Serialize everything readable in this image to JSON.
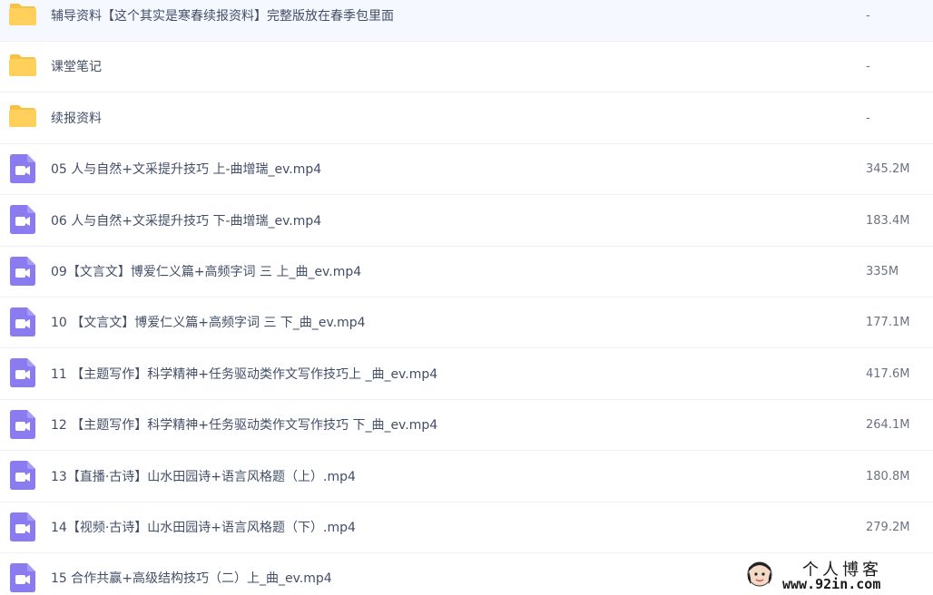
{
  "files": [
    {
      "type": "folder",
      "name": "辅导资料【这个其实是寒春续报资料】完整版放在春季包里面",
      "size": "-"
    },
    {
      "type": "folder",
      "name": "课堂笔记",
      "size": "-"
    },
    {
      "type": "folder",
      "name": "续报资料",
      "size": "-"
    },
    {
      "type": "video",
      "name": "05 人与自然+文采提升技巧 上-曲增瑞_ev.mp4",
      "size": "345.2M"
    },
    {
      "type": "video",
      "name": "06 人与自然+文采提升技巧 下-曲增瑞_ev.mp4",
      "size": "183.4M"
    },
    {
      "type": "video",
      "name": "09【文言文】博爱仁义篇+高频字词 三 上_曲_ev.mp4",
      "size": "335M"
    },
    {
      "type": "video",
      "name": "10 【文言文】博爱仁义篇+高频字词 三 下_曲_ev.mp4",
      "size": "177.1M"
    },
    {
      "type": "video",
      "name": "11 【主题写作】科学精神+任务驱动类作文写作技巧上 _曲_ev.mp4",
      "size": "417.6M"
    },
    {
      "type": "video",
      "name": "12 【主题写作】科学精神+任务驱动类作文写作技巧 下_曲_ev.mp4",
      "size": "264.1M"
    },
    {
      "type": "video",
      "name": "13【直播·古诗】山水田园诗+语言风格题（上）.mp4",
      "size": "180.8M"
    },
    {
      "type": "video",
      "name": "14【视频·古诗】山水田园诗+语言风格题（下）.mp4",
      "size": "279.2M"
    },
    {
      "type": "video",
      "name": "15 合作共赢+高级结构技巧（二）上_曲_ev.mp4",
      "size": ""
    }
  ],
  "icons": {
    "folder": "folder-icon",
    "video": "video-file-icon"
  },
  "colors": {
    "folder": "#ffd15c",
    "folder_tab": "#f7c244",
    "video": "#8a7cf0"
  },
  "watermark": {
    "title": "个人博客",
    "url": "www.92in.com",
    "logo_icon": "blog-avatar-icon"
  }
}
